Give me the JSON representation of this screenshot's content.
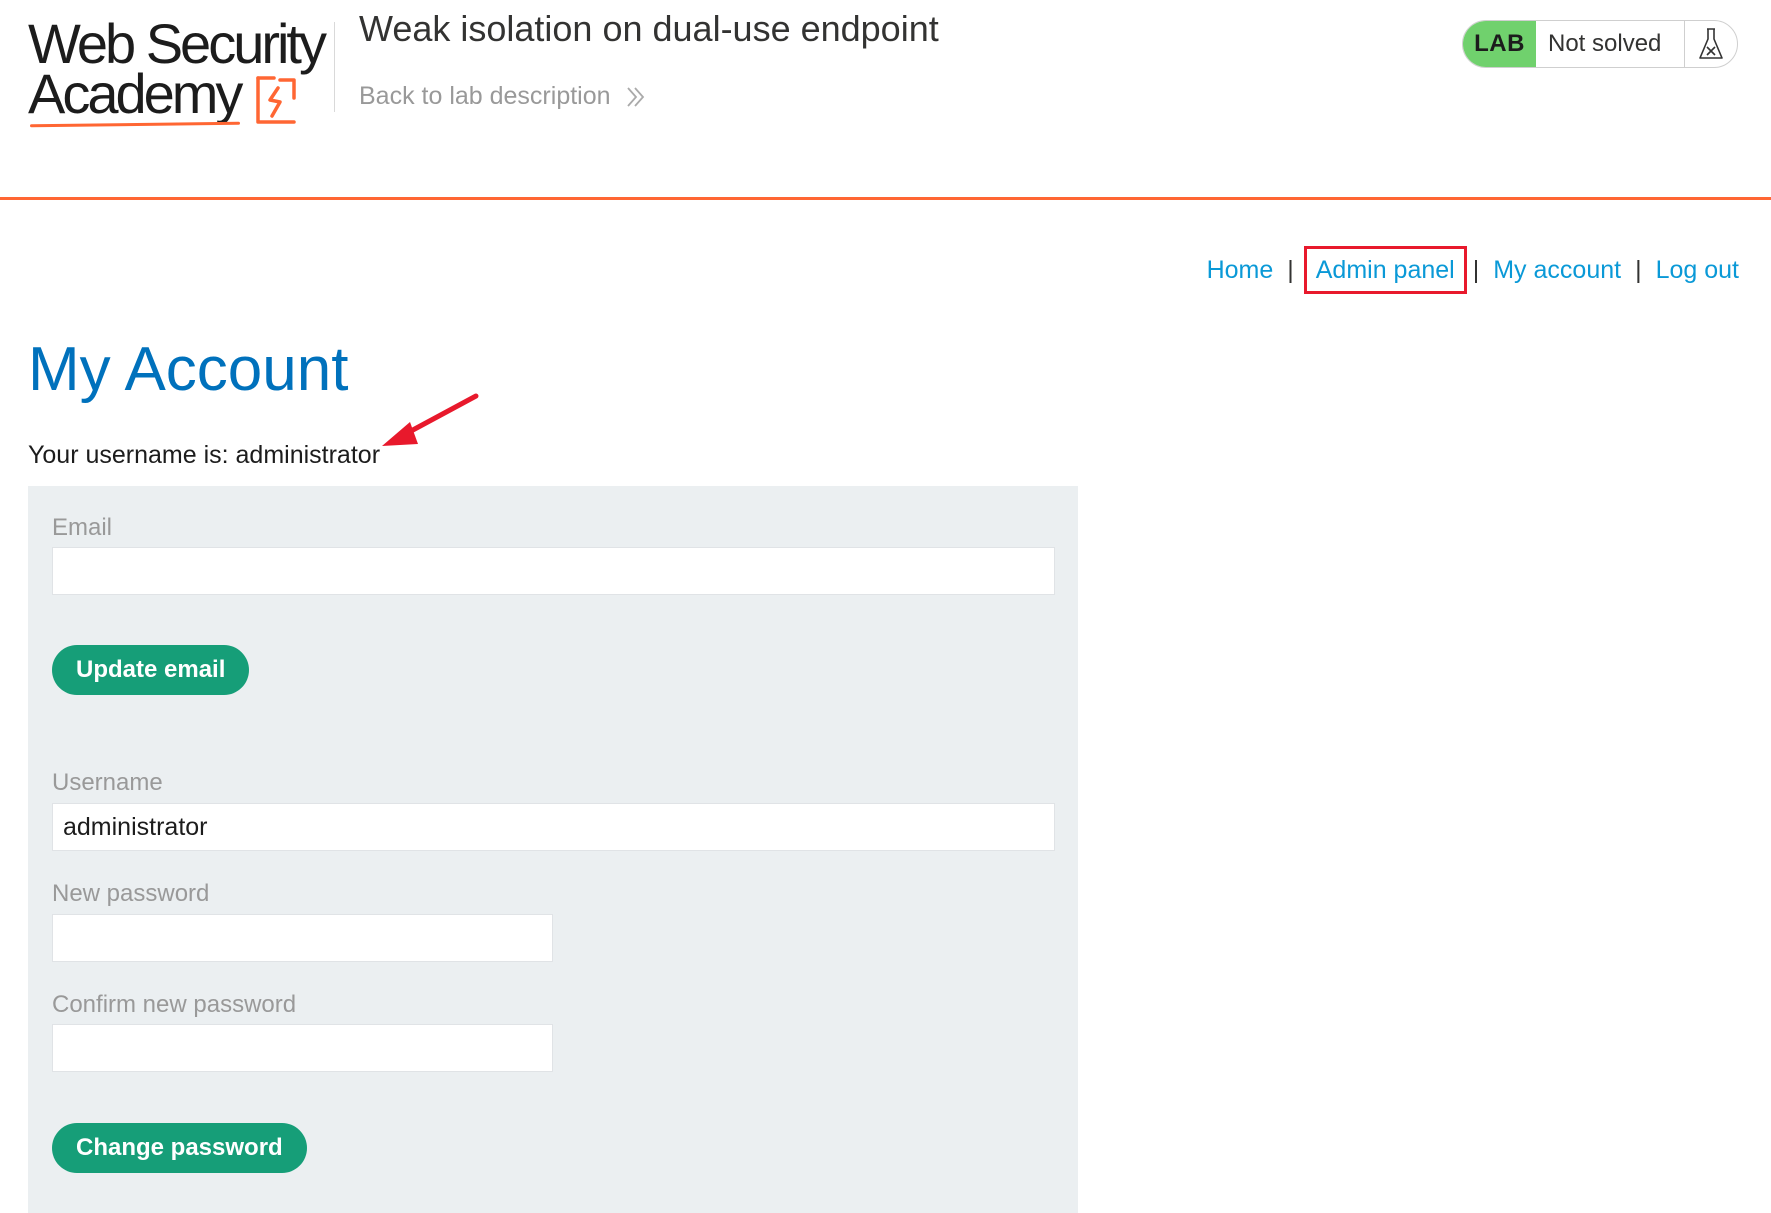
{
  "header": {
    "logo_line1": "Web Security",
    "logo_line2": "Academy",
    "lab_title": "Weak isolation on dual-use endpoint",
    "back_link": "Back to lab description",
    "lab_badge": "LAB",
    "lab_status": "Not solved",
    "lab_status_icon": "flask-icon"
  },
  "nav": {
    "home": "Home",
    "admin_panel": "Admin panel",
    "my_account": "My account",
    "log_out": "Log out",
    "separator": "|"
  },
  "main": {
    "title": "My Account",
    "username_text": "Your username is: administrator"
  },
  "email_form": {
    "label": "Email",
    "value": "",
    "button": "Update email"
  },
  "password_form": {
    "username_label": "Username",
    "username_value": "administrator",
    "new_password_label": "New password",
    "confirm_password_label": "Confirm new password",
    "button": "Change password"
  },
  "colors": {
    "accent_orange": "#ff6633",
    "link_blue": "#0a99d7",
    "title_blue": "#0071bc",
    "button_green": "#169e78",
    "lab_green": "#70d16d",
    "highlight_red": "#e8192c"
  }
}
